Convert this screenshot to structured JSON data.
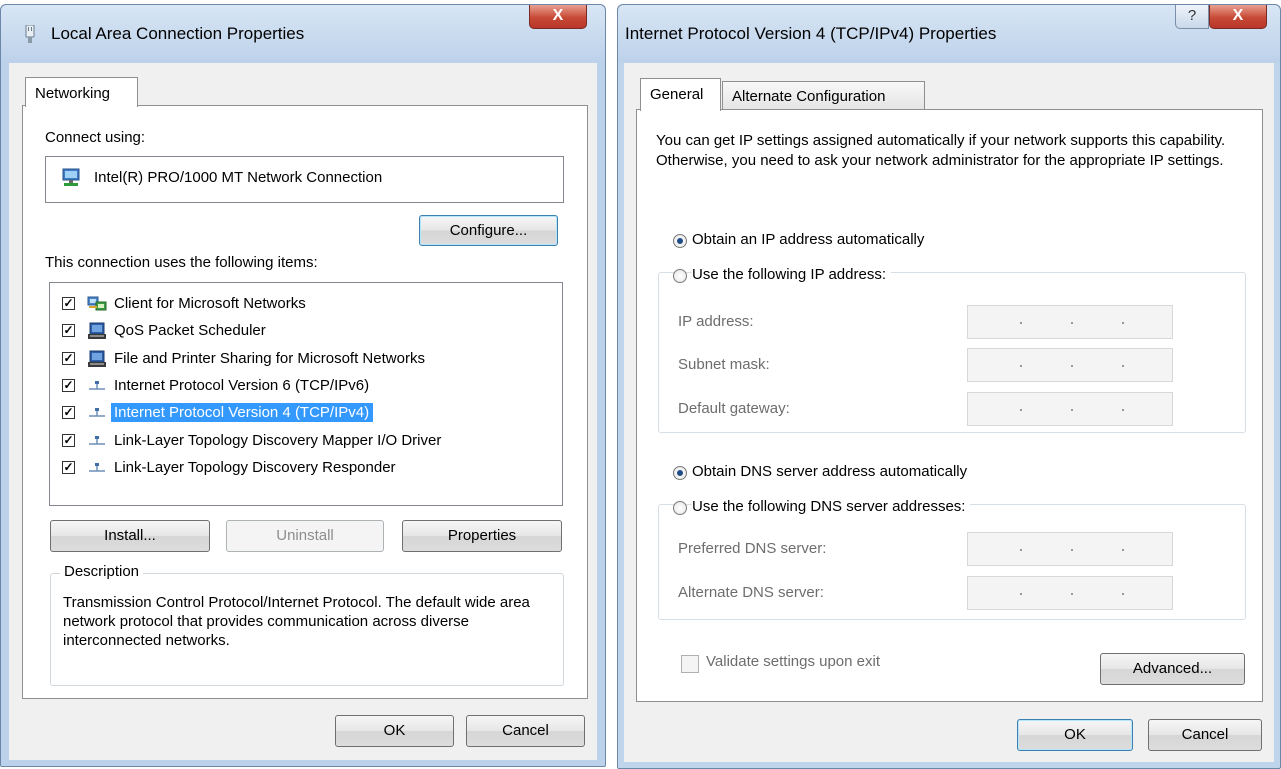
{
  "dialog1": {
    "title": "Local Area Connection Properties",
    "close_label": "X",
    "tab_networking": "Networking",
    "connect_using_label": "Connect using:",
    "adapter_name": "Intel(R) PRO/1000 MT Network Connection",
    "configure_label": "Configure...",
    "items_label": "This connection uses the following items:",
    "items": [
      {
        "label": "Client for Microsoft Networks",
        "checked": true,
        "icon": "network-client-icon"
      },
      {
        "label": "QoS Packet Scheduler",
        "checked": true,
        "icon": "service-icon"
      },
      {
        "label": "File and Printer Sharing for Microsoft Networks",
        "checked": true,
        "icon": "service-icon"
      },
      {
        "label": "Internet Protocol Version 6 (TCP/IPv6)",
        "checked": true,
        "icon": "protocol-icon"
      },
      {
        "label": "Internet Protocol Version 4 (TCP/IPv4)",
        "checked": true,
        "icon": "protocol-icon",
        "selected": true
      },
      {
        "label": "Link-Layer Topology Discovery Mapper I/O Driver",
        "checked": true,
        "icon": "protocol-icon"
      },
      {
        "label": "Link-Layer Topology Discovery Responder",
        "checked": true,
        "icon": "protocol-icon"
      }
    ],
    "install_label": "Install...",
    "uninstall_label": "Uninstall",
    "properties_label": "Properties",
    "description_title": "Description",
    "description_text": "Transmission Control Protocol/Internet Protocol. The default wide area network protocol that provides communication across diverse interconnected networks.",
    "ok_label": "OK",
    "cancel_label": "Cancel"
  },
  "dialog2": {
    "title": "Internet Protocol Version 4 (TCP/IPv4) Properties",
    "help_label": "?",
    "close_label": "X",
    "tab_general": "General",
    "tab_alternate": "Alternate Configuration",
    "intro_text": "You can get IP settings assigned automatically if your network supports this capability. Otherwise, you need to ask your network administrator for the appropriate IP settings.",
    "obtain_ip_auto": "Obtain an IP address automatically",
    "use_following_ip": "Use the following IP address:",
    "ip_address_label": "IP address:",
    "subnet_mask_label": "Subnet mask:",
    "default_gateway_label": "Default gateway:",
    "obtain_dns_auto": "Obtain DNS server address automatically",
    "use_following_dns": "Use the following DNS server addresses:",
    "preferred_dns_label": "Preferred DNS server:",
    "alternate_dns_label": "Alternate DNS server:",
    "validate_label": "Validate settings upon exit",
    "advanced_label": "Advanced...",
    "ok_label": "OK",
    "cancel_label": "Cancel"
  }
}
